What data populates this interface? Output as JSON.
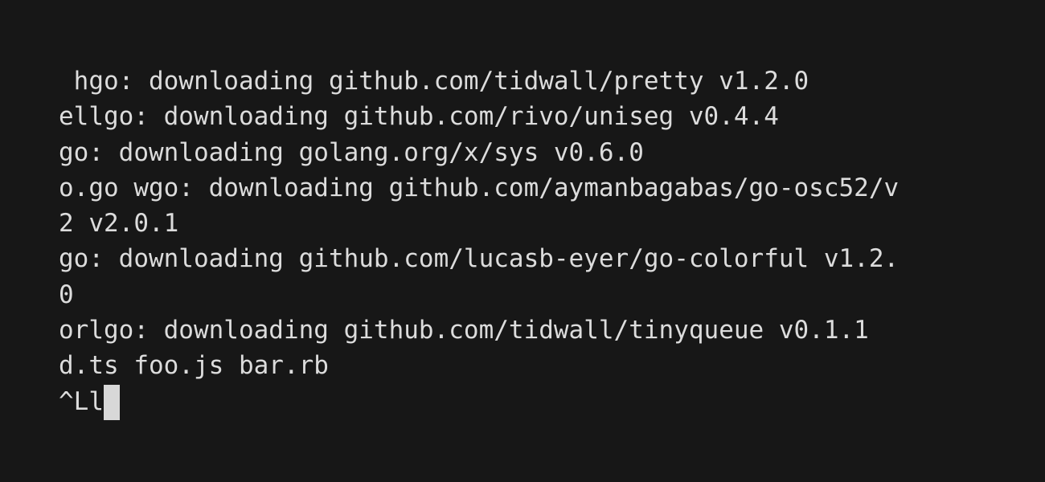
{
  "terminal": {
    "lines": [
      " hgo: downloading github.com/tidwall/pretty v1.2.0",
      "ellgo: downloading github.com/rivo/uniseg v0.4.4",
      "go: downloading golang.org/x/sys v0.6.0",
      "o.go wgo: downloading github.com/aymanbagabas/go-osc52/v",
      "2 v2.0.1",
      "go: downloading github.com/lucasb-eyer/go-colorful v1.2.",
      "0",
      "orlgo: downloading github.com/tidwall/tinyqueue v0.1.1",
      "d.ts foo.js bar.rb"
    ],
    "prompt_input": "^Ll"
  }
}
